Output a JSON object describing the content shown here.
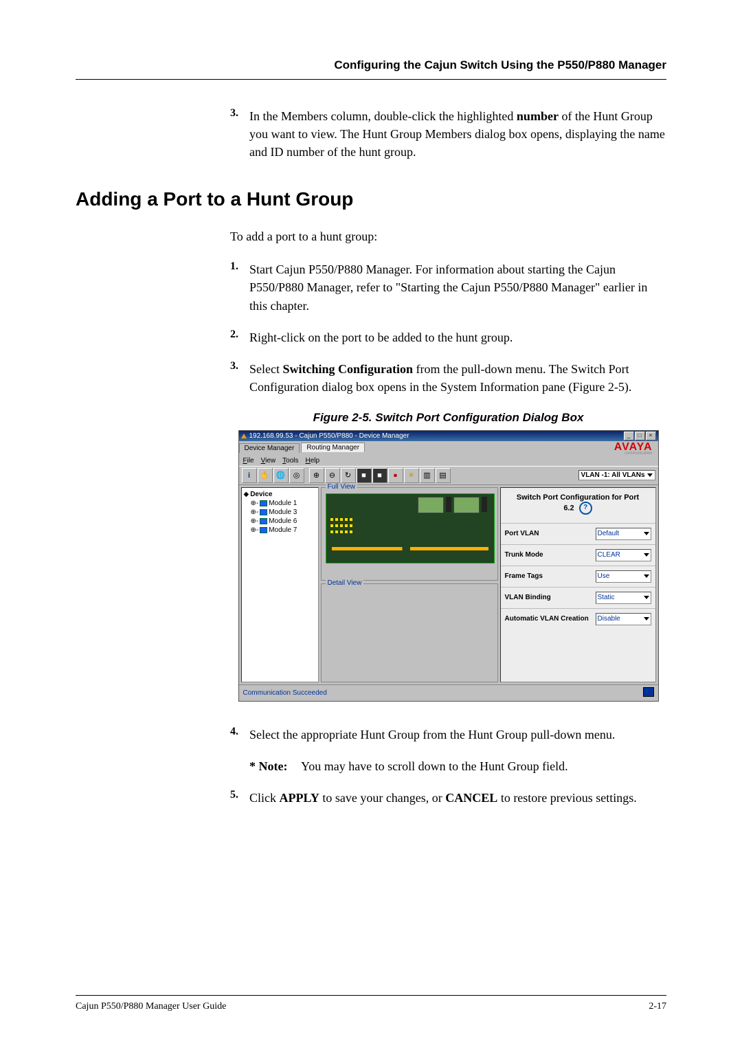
{
  "header": {
    "running_title": "Configuring the Cajun Switch Using the P550/P880 Manager"
  },
  "intro_step": {
    "num": "3.",
    "text_before_bold": "In the Members column, double-click the highlighted ",
    "bold": "number",
    "text_after_bold": " of the Hunt Group you want to view. The Hunt Group Members dialog box opens, displaying the name and ID number of the hunt group."
  },
  "h2": "Adding a Port to a Hunt Group",
  "intro_line": "To add a port to a hunt group:",
  "steps": [
    {
      "num": "1.",
      "html": "Start Cajun P550/P880 Manager. For information about starting the Cajun P550/P880 Manager, refer to \"Starting the Cajun P550/P880 Manager\" earlier in this chapter."
    },
    {
      "num": "2.",
      "html": "Right-click on the port to be added to the hunt group."
    },
    {
      "num": "3.",
      "pre": "Select ",
      "bold": "Switching Configuration",
      "post": " from the pull-down menu. The Switch Port Configuration dialog box opens in the System Information pane (Figure 2-5)."
    }
  ],
  "figure_caption": "Figure 2-5.  Switch Port Configuration Dialog Box",
  "screenshot": {
    "title": "192.168.99.53 - Cajun P550/P880 -  Device Manager",
    "tabs": [
      "Device Manager",
      "Routing Manager"
    ],
    "logo": "AVAYA",
    "logo_sub": "communication",
    "menus": [
      "File",
      "View",
      "Tools",
      "Help"
    ],
    "vlan_label": "VLAN -1: All VLANs",
    "tree": {
      "root": "Device",
      "items": [
        "Module 1",
        "Module 3",
        "Module 6",
        "Module 7"
      ]
    },
    "panels": {
      "full": "Full View",
      "detail": "Detail View"
    },
    "right": {
      "title_line1": "Switch Port Configuration for Port",
      "title_line2": "6.2",
      "rows": [
        {
          "label": "Port VLAN",
          "value": "Default"
        },
        {
          "label": "Trunk Mode",
          "value": "CLEAR"
        },
        {
          "label": "Frame Tags",
          "value": "Use"
        },
        {
          "label": "VLAN Binding",
          "value": "Static"
        },
        {
          "label": "Automatic VLAN Creation",
          "value": "Disable"
        }
      ]
    },
    "status": "Communication Succeeded"
  },
  "post_steps": [
    {
      "num": "4.",
      "text": "Select the appropriate Hunt Group from the Hunt Group pull-down menu."
    }
  ],
  "note": {
    "label": "* Note:",
    "text": "You may have to scroll down to the Hunt Group field."
  },
  "step5": {
    "num": "5.",
    "pre": "Click ",
    "b1": "APPLY",
    "mid": " to save your changes, or ",
    "b2": "CANCEL",
    "post": " to restore previous settings."
  },
  "footer": {
    "left": "Cajun P550/P880 Manager User Guide",
    "right": "2-17"
  }
}
